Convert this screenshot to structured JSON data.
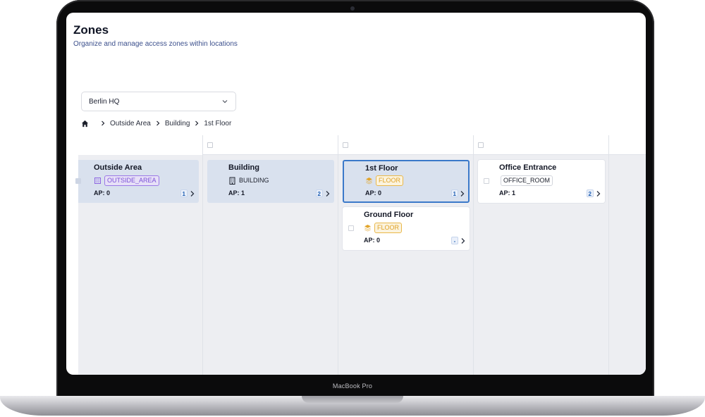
{
  "device": {
    "label": "MacBook Pro"
  },
  "header": {
    "title": "Zones",
    "subtitle": "Organize and manage access zones within locations"
  },
  "location_select": {
    "value": "Berlin HQ"
  },
  "breadcrumb": {
    "items": [
      "Outside Area",
      "Building",
      "1st Floor"
    ]
  },
  "columns": [
    {
      "cards": [
        {
          "name": "Outside Area",
          "type_label": "OUTSIDE_AREA",
          "type_icon": "zone-square-icon",
          "ap": "AP: 0",
          "count": "1",
          "state": "in-path"
        }
      ]
    },
    {
      "cards": [
        {
          "name": "Building",
          "type_label": "BUILDING",
          "type_icon": "building-icon",
          "ap": "AP: 1",
          "count": "2",
          "state": "in-path"
        }
      ]
    },
    {
      "cards": [
        {
          "name": "1st Floor",
          "type_label": "FLOOR",
          "type_icon": "layers-icon",
          "ap": "AP: 0",
          "count": "1",
          "state": "selected"
        },
        {
          "name": "Ground Floor",
          "type_label": "FLOOR",
          "type_icon": "layers-icon",
          "ap": "AP: 0",
          "count": "-",
          "state": "default"
        }
      ]
    },
    {
      "cards": [
        {
          "name": "Office Entrance",
          "type_label": "OFFICE_ROOM",
          "type_icon": "",
          "ap": "AP: 1",
          "count": "2",
          "state": "default"
        }
      ]
    }
  ],
  "colors": {
    "accent": "#3b79c9",
    "path_card": "#d9e1ee",
    "outside_area_badge": "#7a4fd8",
    "floor_badge": "#e0a226",
    "subtitle": "#3b4f8c"
  }
}
